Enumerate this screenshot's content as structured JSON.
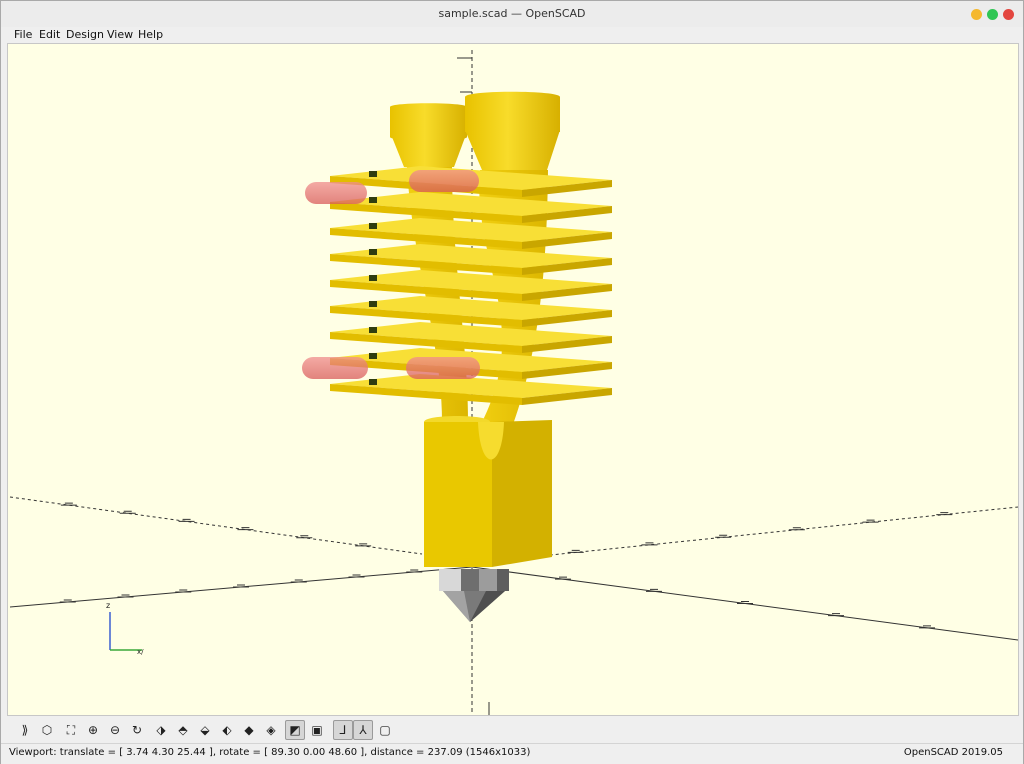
{
  "window": {
    "title": "sample.scad — OpenSCAD",
    "controls": {
      "minimize_color": "#f5b82e",
      "maximize_color": "#2fc654",
      "close_color": "#e3463f"
    }
  },
  "menu": {
    "items": [
      {
        "label": "File"
      },
      {
        "label": "Edit"
      },
      {
        "label": "Design"
      },
      {
        "label": "View"
      },
      {
        "label": "Help"
      }
    ]
  },
  "viewport": {
    "background": "#ffffe5",
    "model_color": "#f5d514",
    "debug_color": "#e45a5a",
    "nozzle_color": "#8c8c8c",
    "axis_mini_labels": {
      "z": "z",
      "xy": "x/"
    }
  },
  "toolbar": {
    "buttons": [
      {
        "icon": "render-preview-icon"
      },
      {
        "icon": "render-icon"
      },
      {
        "icon": "view-all-icon"
      },
      {
        "icon": "zoom-in-icon"
      },
      {
        "icon": "zoom-out-icon"
      },
      {
        "icon": "reset-view-icon"
      },
      {
        "icon": "view-right-icon"
      },
      {
        "icon": "view-top-icon"
      },
      {
        "icon": "view-bottom-icon"
      },
      {
        "icon": "view-left-icon"
      },
      {
        "icon": "view-front-icon"
      },
      {
        "icon": "view-back-icon"
      },
      {
        "icon": "perspective-icon",
        "active": true
      },
      {
        "icon": "orthogonal-icon"
      },
      {
        "icon": "show-axes-icon",
        "active": true
      },
      {
        "icon": "show-scale-markers-icon",
        "active": true
      },
      {
        "icon": "show-edges-icon"
      }
    ]
  },
  "status": {
    "viewport_text": "Viewport: translate = [ 3.74 4.30 25.44 ], rotate = [ 89.30 0.00 48.60 ], distance = 237.09 (1546x1033)",
    "version_text": "OpenSCAD 2019.05"
  }
}
